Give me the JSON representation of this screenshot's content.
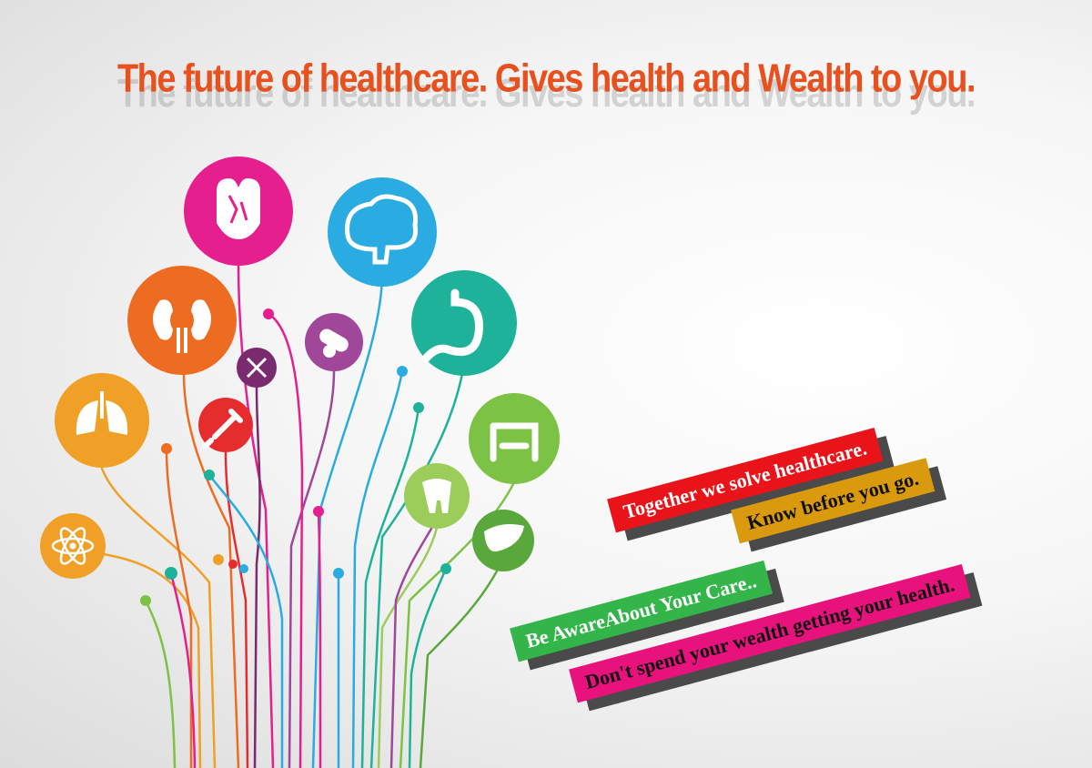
{
  "headline": "The future of healthcare. Gives health and Wealth to you.",
  "colors": {
    "headline": "#e8501e",
    "magenta": "#e61f8e",
    "cyan": "#2aace2",
    "orange": "#ee6c22",
    "teal": "#1fb29a",
    "green": "#7cc244",
    "purple": "#a0479a",
    "red": "#e62d2d",
    "amber": "#f0a026"
  },
  "icons": [
    {
      "name": "heart-icon",
      "color": "magenta"
    },
    {
      "name": "brain-icon",
      "color": "cyan"
    },
    {
      "name": "kidneys-icon",
      "color": "orange"
    },
    {
      "name": "stomach-icon",
      "color": "teal"
    },
    {
      "name": "pills-icon",
      "color": "purple"
    },
    {
      "name": "dna-icon",
      "color": "purple"
    },
    {
      "name": "lungs-icon",
      "color": "orange"
    },
    {
      "name": "syringe-icon",
      "color": "red"
    },
    {
      "name": "intestine-icon",
      "color": "green"
    },
    {
      "name": "tooth-icon",
      "color": "green"
    },
    {
      "name": "liver-icon",
      "color": "green"
    },
    {
      "name": "atom-icon",
      "color": "amber"
    }
  ],
  "banners": [
    {
      "text": "Together we solve healthcare.",
      "color": "#e8141a"
    },
    {
      "text": "Know before you go.",
      "color": "#d99a0e"
    },
    {
      "text": "Be AwareAbout Your Care..",
      "color": "#33b54a"
    },
    {
      "text": "Don't spend your wealth  getting your health.",
      "color": "#e8127c"
    }
  ]
}
